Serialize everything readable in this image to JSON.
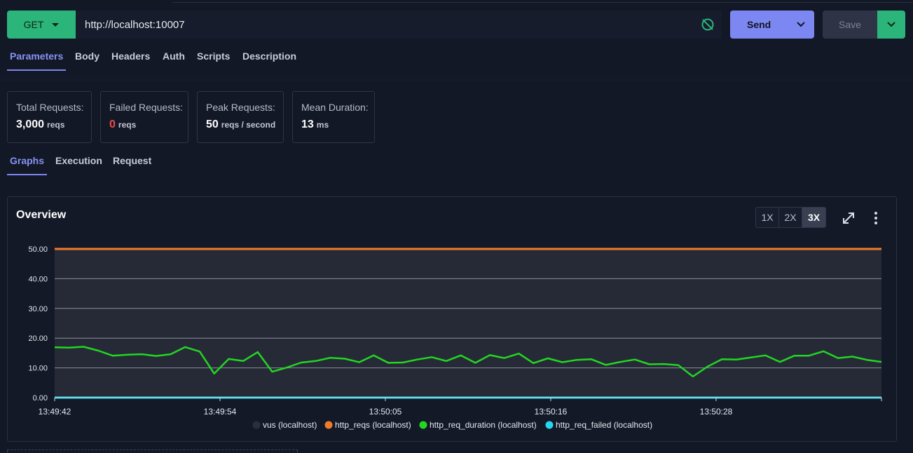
{
  "request": {
    "method": "GET",
    "url": "http://localhost:10007",
    "send_label": "Send",
    "save_label": "Save"
  },
  "request_tabs": [
    {
      "label": "Parameters",
      "active": true
    },
    {
      "label": "Body",
      "active": false
    },
    {
      "label": "Headers",
      "active": false
    },
    {
      "label": "Auth",
      "active": false
    },
    {
      "label": "Scripts",
      "active": false
    },
    {
      "label": "Description",
      "active": false
    }
  ],
  "stats": {
    "total": {
      "label": "Total Requests:",
      "value": "3,000",
      "unit": "reqs"
    },
    "failed": {
      "label": "Failed Requests:",
      "value": "0",
      "unit": "reqs"
    },
    "peak": {
      "label": "Peak Requests:",
      "value": "50",
      "unit": "reqs / second"
    },
    "mean": {
      "label": "Mean Duration:",
      "value": "13",
      "unit": "ms"
    }
  },
  "result_tabs": [
    {
      "label": "Graphs",
      "active": true
    },
    {
      "label": "Execution",
      "active": false
    },
    {
      "label": "Request",
      "active": false
    }
  ],
  "panel": {
    "title": "Overview",
    "zoom_options": [
      "1X",
      "2X",
      "3X"
    ],
    "zoom_selected": "3X"
  },
  "colors": {
    "accent": "#7d87f1",
    "method_green": "#2bb57a",
    "failed_red": "#ef4b4b"
  },
  "chart_data": {
    "type": "line",
    "title": "",
    "xlabel": "",
    "ylabel": "",
    "ylim": [
      0,
      50
    ],
    "y_ticks": [
      "0.00",
      "10.00",
      "20.00",
      "30.00",
      "40.00",
      "50.00"
    ],
    "x_ticks": [
      "13:49:42",
      "13:49:54",
      "13:50:05",
      "13:50:16",
      "13:50:28"
    ],
    "grid": true,
    "legend_position": "bottom",
    "series": [
      {
        "name": "vus (localhost)",
        "color": "#2a2f3d",
        "values": []
      },
      {
        "name": "http_reqs (localhost)",
        "color": "#f07a2a",
        "values": [
          50,
          50
        ]
      },
      {
        "name": "http_req_duration (localhost)",
        "color": "#22d622",
        "values": [
          16.9,
          16.8,
          17.1,
          15.8,
          14.1,
          14.4,
          14.6,
          14.0,
          14.6,
          17.0,
          15.5,
          8.1,
          13.0,
          12.3,
          15.3,
          8.7,
          10.1,
          11.8,
          12.3,
          13.4,
          13.1,
          11.9,
          14.2,
          11.7,
          11.8,
          12.8,
          13.6,
          12.3,
          14.2,
          11.7,
          14.3,
          13.3,
          14.8,
          11.6,
          13.2,
          11.9,
          12.7,
          12.9,
          11.0,
          12.0,
          12.8,
          11.2,
          11.3,
          10.9,
          7.1,
          10.4,
          12.9,
          12.8,
          13.5,
          14.2,
          12.0,
          14.1,
          14.1,
          15.6,
          13.3,
          13.8,
          12.7,
          12.0
        ]
      },
      {
        "name": "http_req_failed (localhost)",
        "color": "#22d7f0",
        "values": [
          0,
          0
        ]
      }
    ]
  }
}
